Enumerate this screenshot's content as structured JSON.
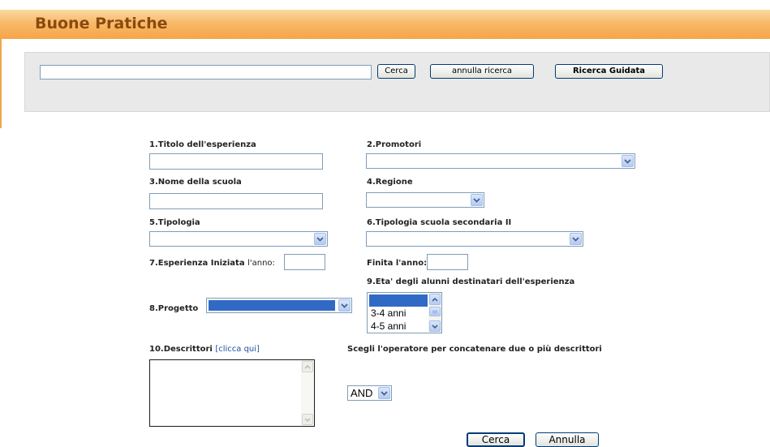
{
  "header": {
    "title": "Buone Pratiche"
  },
  "search": {
    "query": "",
    "cerca_label": "Cerca",
    "annulla_label": "annulla ricerca",
    "guidata_label": "Ricerca Guidata"
  },
  "form": {
    "titolo_label": "1.Titolo dell'esperienza",
    "titolo_value": "",
    "promotori_label": "2.Promotori",
    "promotori_value": "",
    "scuola_label": "3.Nome della scuola",
    "scuola_value": "",
    "regione_label": "4.Regione",
    "regione_value": "",
    "tipologia_label": "5.Tipologia",
    "tipologia_value": "",
    "tipologia_sec_label": "6.Tipologia scuola secondaria II",
    "tipologia_sec_value": "",
    "iniziata_label": "7.Esperienza Iniziata",
    "iniziata_suffix": "l'anno:",
    "iniziata_value": "",
    "finita_label": "Finita l'anno:",
    "finita_value": "",
    "eta_label": "9.Eta' degli alunni destinatari dell'esperienza",
    "eta_options": [
      "",
      "3-4 anni",
      "4-5 anni"
    ],
    "progetto_label": "8.Progetto",
    "progetto_value": "",
    "descrittori_label": "10.Descrittori",
    "descrittori_link": "[clicca qui]",
    "operatore_label": "Scegli l'operatore per concatenare due o più descrittori",
    "operatore_value": "AND",
    "cerca_label": "Cerca",
    "annulla_label": "Annulla"
  },
  "colors": {
    "header_orange": "#f5a547",
    "title_brown": "#8a4a0e",
    "selected_blue": "#316ac5",
    "link_blue": "#2050a0"
  }
}
